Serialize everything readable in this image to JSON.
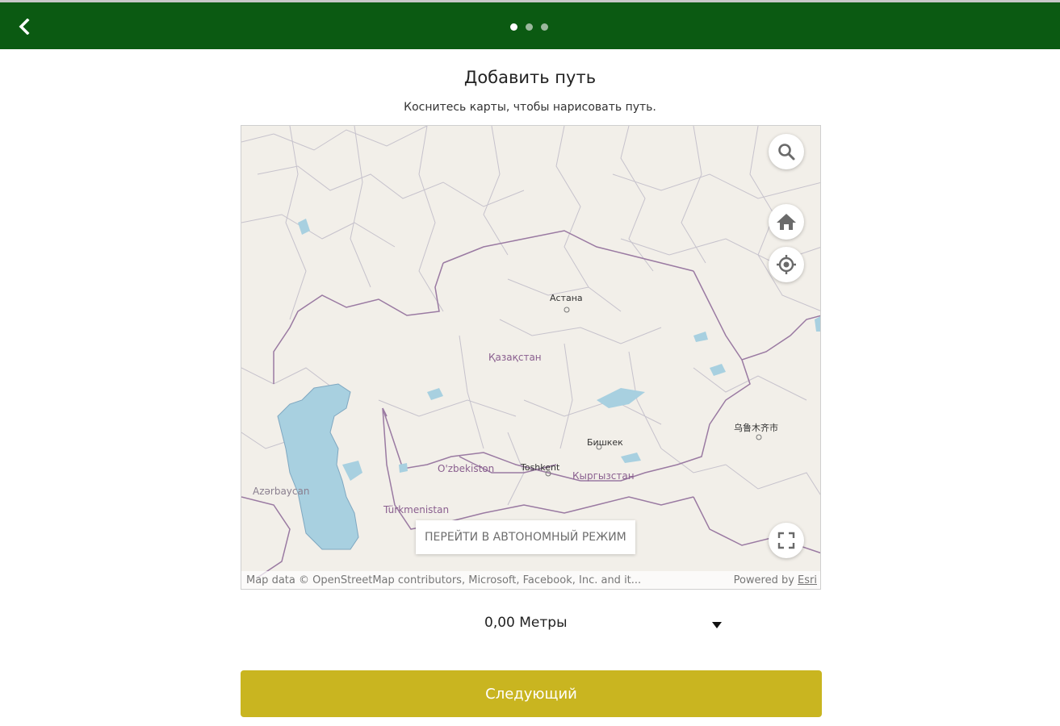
{
  "header": {
    "back_icon": "chevron-left-icon",
    "step_dots": {
      "total": 3,
      "active_index": 0
    },
    "colors": {
      "bar": "#0b5a12"
    }
  },
  "page": {
    "title": "Добавить путь",
    "subtitle": "Коснитесь карты, чтобы нарисовать путь."
  },
  "map": {
    "labels": {
      "astana": "Астана",
      "kazakhstan": "Қазақстан",
      "bishkek": "Бишкек",
      "urumqi": "乌鲁木齐市",
      "uzbekistan": "O'zbekiston",
      "tashkent": "Toshkent",
      "kyrgyzstan": "Кыргызстан",
      "turkmenistan": "Türkmenistan",
      "azerbaijan": "Azərbaycan"
    },
    "controls": {
      "search_icon": "search-icon",
      "home_icon": "home-icon",
      "locate_icon": "locate-icon",
      "fullscreen_icon": "fullscreen-icon"
    },
    "offline_button_label": "ПЕРЕЙТИ В АВТОНОМНЫЙ РЕЖИМ",
    "attribution_left": "Map data © OpenStreetMap contributors, Microsoft, Facebook, Inc. and it...",
    "attribution_powered": "Powered by ",
    "attribution_esri": "Esri"
  },
  "measurement": {
    "distance_value": "0,00",
    "distance_unit": "Метры",
    "dropdown_icon": "caret-down-icon"
  },
  "footer": {
    "next_label": "Следующий",
    "colors": {
      "next_button": "#c9b520"
    }
  }
}
